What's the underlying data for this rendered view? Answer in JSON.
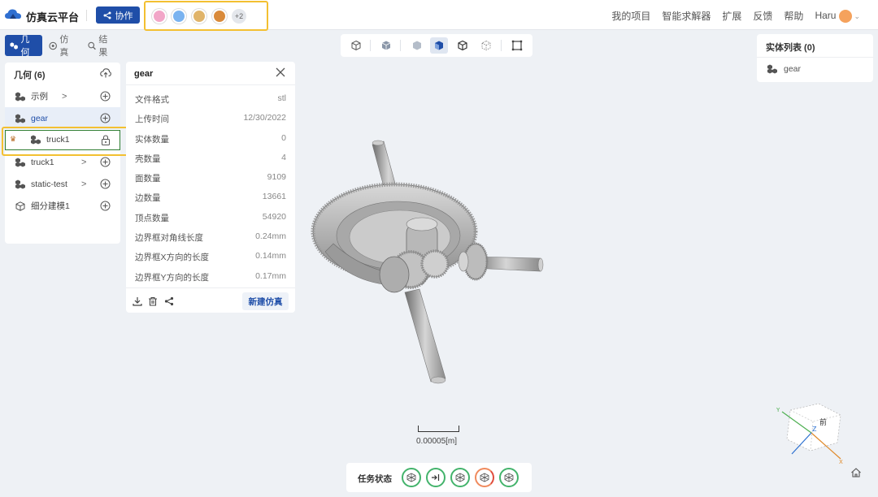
{
  "app": {
    "title": "仿真云平台",
    "collab_label": "协作",
    "more_users": "+2"
  },
  "topnav": {
    "items": [
      "我的项目",
      "智能求解器",
      "扩展",
      "反馈",
      "帮助"
    ],
    "user": "Haru"
  },
  "tabs": [
    {
      "label": "几何",
      "icon": "geometry-icon"
    },
    {
      "label": "仿真",
      "icon": "simulation-icon"
    },
    {
      "label": "结果",
      "icon": "results-icon"
    }
  ],
  "geometry": {
    "header": "几何 (6)",
    "items": [
      {
        "label": "示例",
        "caret": ">",
        "icon": "cubes-icon"
      },
      {
        "label": "gear",
        "icon": "cubes-icon"
      },
      {
        "label": "truck1",
        "icon": "cubes-icon",
        "locked": true
      },
      {
        "label": "truck1",
        "caret": ">",
        "icon": "cubes-icon"
      },
      {
        "label": "static-test",
        "caret": ">",
        "icon": "cubes-icon"
      },
      {
        "label": "细分建模1",
        "icon": "cube-icon"
      }
    ]
  },
  "properties": {
    "title": "gear",
    "rows": [
      {
        "k": "文件格式",
        "v": "stl"
      },
      {
        "k": "上传时间",
        "v": "12/30/2022"
      },
      {
        "k": "实体数量",
        "v": "0"
      },
      {
        "k": "壳数量",
        "v": "4"
      },
      {
        "k": "面数量",
        "v": "9109"
      },
      {
        "k": "边数量",
        "v": "13661"
      },
      {
        "k": "顶点数量",
        "v": "54920"
      },
      {
        "k": "边界框对角线长度",
        "v": "0.24mm"
      },
      {
        "k": "边界框X方向的长度",
        "v": "0.14mm"
      },
      {
        "k": "边界框Y方向的长度",
        "v": "0.17mm"
      }
    ],
    "new_sim_label": "新建仿真"
  },
  "entities": {
    "header": "实体列表 (0)",
    "items": [
      "gear"
    ]
  },
  "viewport": {
    "scale_label": "0.00005[m]"
  },
  "gizmo": {
    "front_label": "前",
    "x": "X",
    "y": "Y",
    "z": "Z"
  },
  "task": {
    "label": "任务状态"
  },
  "colors": {
    "primary": "#1f4ea8",
    "highlight": "#f3c031",
    "success": "#43b36b",
    "selected_border": "#2e7d32"
  }
}
